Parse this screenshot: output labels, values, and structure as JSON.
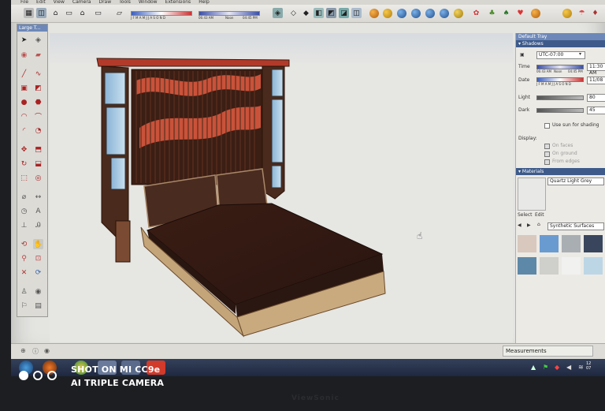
{
  "menu": [
    "File",
    "Edit",
    "View",
    "Camera",
    "Draw",
    "Tools",
    "Window",
    "Extensions",
    "Help"
  ],
  "toolbar": {
    "shadow_months": "J F M A M J J A S O N D",
    "time_start": "06:43 AM",
    "time_noon": "Noon",
    "time_end": "04:45 PM"
  },
  "palette": {
    "title": "Large T..."
  },
  "tray": {
    "title": "Default Tray",
    "shadows": {
      "header": "Shadows",
      "timezone": "UTC-07:00",
      "time_label": "Time",
      "time_value": "11:30 AM",
      "time_start": "06:43 AM",
      "time_noon": "Noon",
      "time_end": "04:45 PM",
      "date_label": "Date",
      "date_months": "J F M A M J J A S O N D",
      "date_value": "11/08",
      "light_label": "Light",
      "light_value": "80",
      "dark_label": "Dark",
      "dark_value": "45",
      "use_sun_label": "Use sun for shading",
      "display_label": "Display:",
      "on_faces": "On faces",
      "on_ground": "On ground",
      "from_edges": "From edges"
    },
    "materials": {
      "header": "Materials",
      "current_name": "Quartz Light Grey",
      "tab_select": "Select",
      "tab_edit": "Edit",
      "library": "Synthetic Surfaces",
      "swatches": [
        "#d8c8be",
        "#6a9bd0",
        "#a9aeb3",
        "#39455c",
        "#5e88a8",
        "#cfcfcb",
        "#f1f1ef",
        "#bcd6e6"
      ]
    }
  },
  "status": {
    "measurements_label": "Measurements"
  },
  "watermark": {
    "line1": "SHOT ON MI CC9e",
    "line2": "AI TRIPLE CAMERA"
  },
  "clock": {
    "time": "12",
    "date": "07"
  },
  "bezel": {
    "brand": "ViewSonic"
  }
}
